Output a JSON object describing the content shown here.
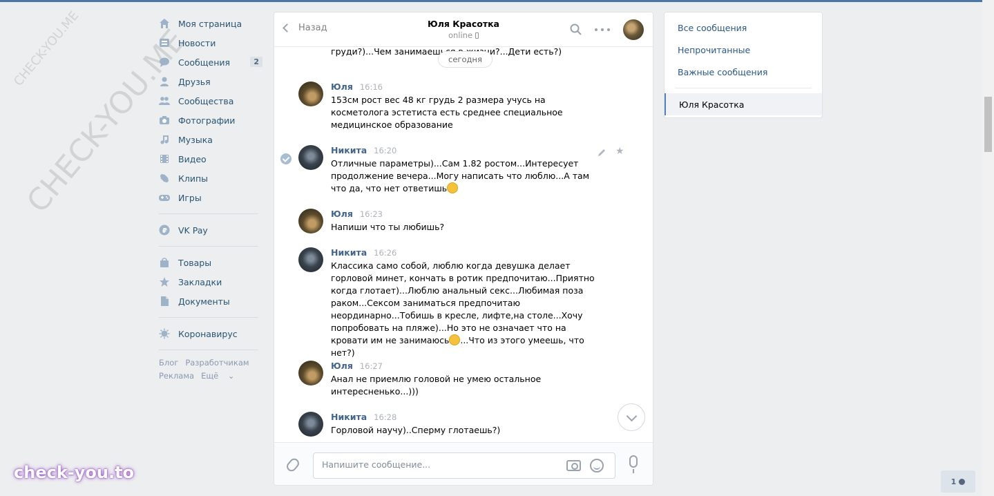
{
  "nav": {
    "items": [
      {
        "label": "Моя страница",
        "icon": "home-icon"
      },
      {
        "label": "Новости",
        "icon": "news-icon"
      },
      {
        "label": "Сообщения",
        "icon": "messages-icon",
        "count": "2"
      },
      {
        "label": "Друзья",
        "icon": "friends-icon"
      },
      {
        "label": "Сообщества",
        "icon": "groups-icon"
      },
      {
        "label": "Фотографии",
        "icon": "camera-icon"
      },
      {
        "label": "Музыка",
        "icon": "music-icon"
      },
      {
        "label": "Видео",
        "icon": "video-icon"
      },
      {
        "label": "Клипы",
        "icon": "clips-icon"
      },
      {
        "label": "Игры",
        "icon": "gamepad-icon"
      }
    ],
    "vkpay": "VK Pay",
    "items2": [
      {
        "label": "Товары",
        "icon": "bag-icon"
      },
      {
        "label": "Закладки",
        "icon": "star-icon"
      },
      {
        "label": "Документы",
        "icon": "document-icon"
      }
    ],
    "corona": "Коронавирус",
    "footer": [
      "Блог",
      "Разработчикам",
      "Реклама",
      "Ещё"
    ]
  },
  "chat": {
    "back": "Назад",
    "peer_name": "Юля Красотка",
    "peer_status": "online",
    "date_pill": "сегодня",
    "cut_text": "груди?)...Чем занимаешься в жизни?...Дети есть?)",
    "messages": [
      {
        "name": "Юля",
        "time": "16:16",
        "text": "153см рост вес 48 кг грудь 2 размера учусь на косметолога эстетиста есть среднее специальное медицинское образование"
      },
      {
        "name": "Никита",
        "time": "16:20",
        "text": "Отличные параметры)...Сам 1.82 ростом...Интересует продолжение вечера...Могу написать что люблю...А там что да, что нет ответишь"
      },
      {
        "name": "Юля",
        "time": "16:23",
        "text": "Напиши что ты любишь?"
      },
      {
        "name": "Никита",
        "time": "16:26",
        "text": "Классика само собой, люблю когда девушка делает горловой минет, кончать в ротик предпочитаю...Приятно когда глотает)...Люблю анальный секс...Любимая поза раком...Сексом заниматься предпочитаю неординарно...Тобишь в кресле, лифте,на столе...Хочу попробовать на пляже)...Но это не означает что на кровати им не занимаюсь",
        "text_tail": "...Что из этого умеешь, что нет?)"
      },
      {
        "name": "Юля",
        "time": "16:27",
        "text": "Анал не приемлю головой не умею остальное интересненько...)))"
      },
      {
        "name": "Никита",
        "time": "16:28",
        "text": "Горловой научу)..Сперму глотаешь?)"
      }
    ],
    "composer_placeholder": "Напишите сообщение..."
  },
  "right": {
    "links": [
      "Все сообщения",
      "Непрочитанные",
      "Важные сообщения"
    ],
    "active": "Юля Красотка"
  },
  "friends_online": "1",
  "watermark": "CHECK-YOU.ME",
  "brand": "check-you.to"
}
